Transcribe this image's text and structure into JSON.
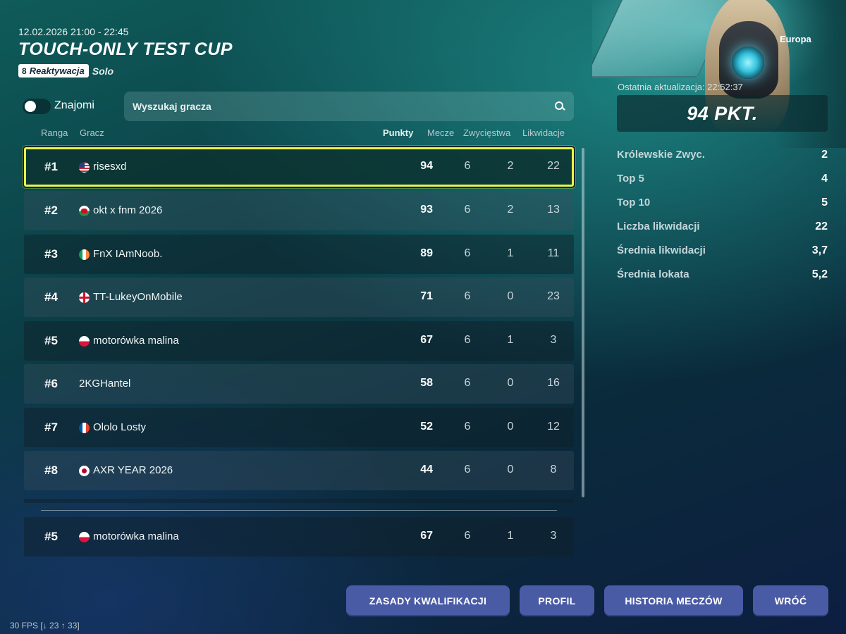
{
  "header": {
    "datetime": "12.02.2026 21:00 - 22:45",
    "title": "TOUCH-ONLY TEST CUP",
    "mode_badge": "Reaktywacja",
    "mode_sub": "Solo"
  },
  "filters": {
    "friends_label": "Znajomi",
    "friends_toggle_on": false,
    "search_placeholder": "Wyszukaj gracza"
  },
  "table": {
    "columns": {
      "rank": "Ranga",
      "player": "Gracz",
      "points": "Punkty",
      "matches": "Mecze",
      "wins": "Zwycięstwa",
      "kills": "Likwidacje"
    },
    "rows": [
      {
        "rank": "#1",
        "flag": "us-flag",
        "name": "risesxd",
        "points": "94",
        "matches": "6",
        "wins": "2",
        "kills": "22"
      },
      {
        "rank": "#2",
        "flag": "wales-flag",
        "name": "okt x fnm 2026",
        "points": "93",
        "matches": "6",
        "wins": "2",
        "kills": "13"
      },
      {
        "rank": "#3",
        "flag": "ireland-flag",
        "name": "FnX IAmNoob.",
        "points": "89",
        "matches": "6",
        "wins": "1",
        "kills": "11"
      },
      {
        "rank": "#4",
        "flag": "england-flag",
        "name": "TT-LukeyOnMobile",
        "points": "71",
        "matches": "6",
        "wins": "0",
        "kills": "23"
      },
      {
        "rank": "#5",
        "flag": "poland-flag",
        "name": "motorówka malina",
        "points": "67",
        "matches": "6",
        "wins": "1",
        "kills": "3"
      },
      {
        "rank": "#6",
        "flag": "",
        "name": "2KGHantel",
        "points": "58",
        "matches": "6",
        "wins": "0",
        "kills": "16"
      },
      {
        "rank": "#7",
        "flag": "france-flag",
        "name": "Ololo Losty",
        "points": "52",
        "matches": "6",
        "wins": "0",
        "kills": "12"
      },
      {
        "rank": "#8",
        "flag": "japan-flag",
        "name": "AXR YEAR 2026",
        "points": "44",
        "matches": "6",
        "wins": "0",
        "kills": "8"
      }
    ],
    "own_row": {
      "rank": "#5",
      "flag": "poland-flag",
      "name": "motorówka malina",
      "points": "67",
      "matches": "6",
      "wins": "1",
      "kills": "3"
    }
  },
  "panel": {
    "region": "Europa",
    "last_update": "Ostatnia aktualizacja: 22:52:37",
    "points": "94 PKT.",
    "stats": [
      {
        "label": "Królewskie Zwyc.",
        "value": "2"
      },
      {
        "label": "Top 5",
        "value": "4"
      },
      {
        "label": "Top 10",
        "value": "5"
      },
      {
        "label": "Liczba likwidacji",
        "value": "22"
      },
      {
        "label": "Średnia likwidacji",
        "value": "3,7"
      },
      {
        "label": "Średnia lokata",
        "value": "5,2"
      }
    ]
  },
  "buttons": {
    "rules": "ZASADY KWALIFIKACJI",
    "profile": "PROFIL",
    "history": "HISTORIA MECZÓW",
    "back": "WRÓĆ"
  },
  "debug": {
    "fps": "30 FPS [↓ 23 ↑ 33]"
  },
  "colors": {
    "highlight": "#e9f548",
    "button": "#4a5ba6"
  }
}
